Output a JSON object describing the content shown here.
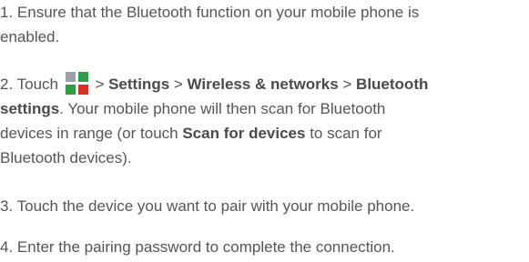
{
  "steps": [
    {
      "number": "1.",
      "lines": [
        "Ensure that the Bluetooth function on your mobile phone is",
        "enabled."
      ]
    },
    {
      "number": "2.",
      "touch": "Touch",
      "sep1": " > ",
      "settings": "Settings",
      "sep2": " > ",
      "wireless": "Wireless & networks",
      "sep3": " > ",
      "bluetooth": "Bluetooth",
      "bluetooth_settings_tail": "settings",
      "text_after_settings": ". Your mobile phone will then scan for Bluetooth",
      "line3": "devices in range (or touch ",
      "scan": "Scan for devices",
      "line3_tail": " to scan for",
      "line4": "Bluetooth devices)."
    },
    {
      "number": "3.",
      "text": "Touch the device you want to pair with your mobile phone."
    },
    {
      "number": "4.",
      "text": "Enter the pairing password to complete the connection."
    }
  ],
  "icons": {
    "menu_icon": "application-grid-icon",
    "menu_icon_colors": [
      "#ffffff",
      "#9aa0a6",
      "#2e9e44",
      "#d93025"
    ]
  }
}
